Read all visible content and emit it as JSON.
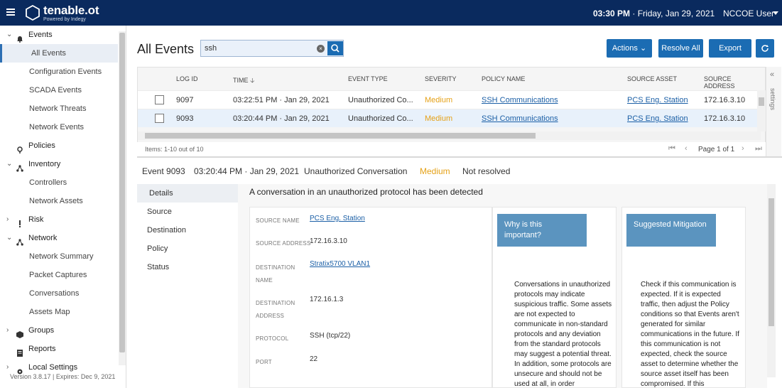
{
  "app": {
    "logo_main": "tenable.ot",
    "logo_sub": "Powered by Indegy",
    "time": "03:30 PM",
    "date": "· Friday, Jan 29, 2021",
    "user": "NCCOE User"
  },
  "sidebar": {
    "items": [
      {
        "label": "Events",
        "icon": "bell-icon",
        "type": "group",
        "expanded": true
      },
      {
        "label": "All Events",
        "type": "sub",
        "active": true
      },
      {
        "label": "Configuration Events",
        "type": "sub"
      },
      {
        "label": "SCADA Events",
        "type": "sub"
      },
      {
        "label": "Network Threats",
        "type": "sub"
      },
      {
        "label": "Network Events",
        "type": "sub"
      },
      {
        "label": "Policies",
        "icon": "pin-icon",
        "type": "group"
      },
      {
        "label": "Inventory",
        "icon": "network-icon",
        "type": "group",
        "expanded": true
      },
      {
        "label": "Controllers",
        "type": "sub"
      },
      {
        "label": "Network Assets",
        "type": "sub"
      },
      {
        "label": "Risk",
        "icon": "alert-icon",
        "type": "group",
        "expanded": false
      },
      {
        "label": "Network",
        "icon": "network-icon",
        "type": "group",
        "expanded": true
      },
      {
        "label": "Network Summary",
        "type": "sub"
      },
      {
        "label": "Packet Captures",
        "type": "sub"
      },
      {
        "label": "Conversations",
        "type": "sub"
      },
      {
        "label": "Assets Map",
        "type": "sub"
      },
      {
        "label": "Groups",
        "icon": "cube-icon",
        "type": "group",
        "expanded": false
      },
      {
        "label": "Reports",
        "icon": "report-icon",
        "type": "group"
      },
      {
        "label": "Local Settings",
        "icon": "gear-icon",
        "type": "group",
        "expanded": false
      }
    ],
    "version": "Version 3.8.17 | Expires: Dec 9, 2021"
  },
  "main": {
    "title": "All Events",
    "search_value": "ssh",
    "buttons": {
      "actions": "Actions",
      "resolve_all": "Resolve All",
      "export": "Export"
    },
    "columns": [
      "LOG ID",
      "TIME",
      "EVENT TYPE",
      "SEVERITY",
      "POLICY NAME",
      "SOURCE ASSET",
      "SOURCE ADDRESS"
    ],
    "rows": [
      {
        "log_id": "9097",
        "time": "03:22:51 PM · Jan 29, 2021",
        "event_type": "Unauthorized Co...",
        "severity": "Medium",
        "policy": "SSH Communications",
        "source_asset": "PCS Eng. Station",
        "source_address": "172.16.3.10"
      },
      {
        "log_id": "9093",
        "time": "03:20:44 PM · Jan 29, 2021",
        "event_type": "Unauthorized Co...",
        "severity": "Medium",
        "policy": "SSH Communications",
        "source_asset": "PCS Eng. Station",
        "source_address": "172.16.3.10"
      }
    ],
    "items_text": "Items: 1-10 out of 10",
    "page_text": "Page 1 of 1",
    "settings_label": "settings"
  },
  "event": {
    "id": "Event 9093",
    "time": "03:20:44 PM · Jan 29, 2021",
    "type": "Unauthorized Conversation",
    "severity": "Medium",
    "status": "Not resolved",
    "tabs": [
      "Details",
      "Source",
      "Destination",
      "Policy",
      "Status"
    ],
    "headline": "A conversation in an unauthorized protocol has been detected",
    "props": {
      "source_name_key": "SOURCE NAME",
      "source_name": "PCS Eng. Station",
      "source_address_key": "SOURCE ADDRESS",
      "source_address": "172.16.3.10",
      "dest_name_key_1": "DESTINATION",
      "dest_name_key_2": "NAME",
      "dest_name": "Stratix5700 VLAN1",
      "dest_address_key_1": "DESTINATION",
      "dest_address_key_2": "ADDRESS",
      "dest_address": "172.16.1.3",
      "protocol_key": "PROTOCOL",
      "protocol": "SSH (tcp/22)",
      "port_key": "PORT",
      "port": "22"
    },
    "why_title": "Why is this important?",
    "why_body": "Conversations in unauthorized protocols may indicate suspicious traffic. Some assets are not expected to communicate in non-standard protocols and any deviation from the standard protocols may suggest a potential threat. In addition, some protocols are unsecure and should not be used at all, in order",
    "mitigation_title": "Suggested Mitigation",
    "mitigation_body": "Check if this communication is expected. If it is expected traffic, then adjust the Policy conditions so that Events aren't generated for similar communications in the future. If this communication is not expected, check the source asset to determine whether the source asset itself has been compromised. If this"
  },
  "colors": {
    "topbar": "#0a2a5e",
    "primary": "#1b6cb3",
    "medium_severity": "#e5a117",
    "card_header": "#5b94bf"
  }
}
